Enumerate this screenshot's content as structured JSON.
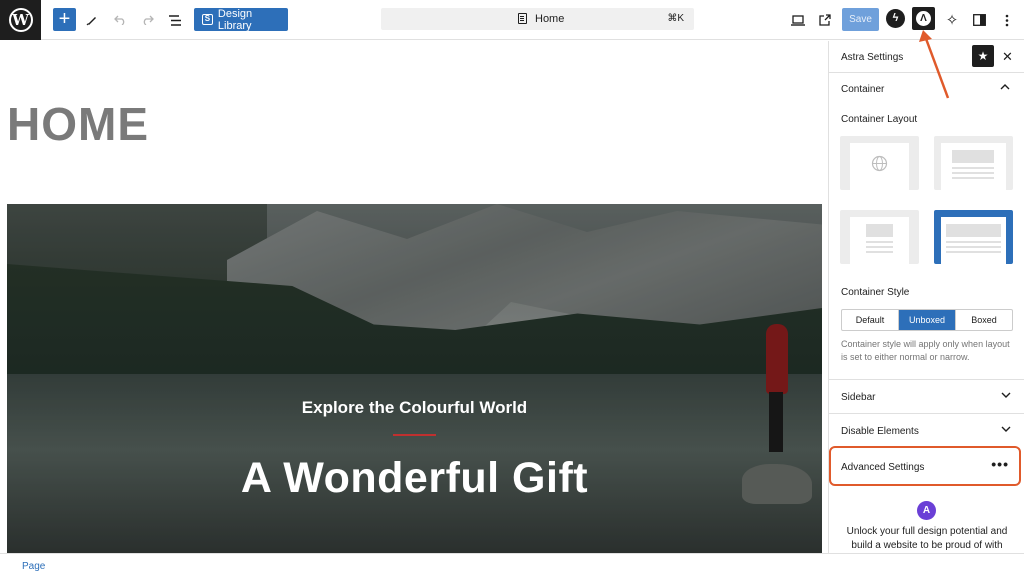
{
  "toolbar": {
    "logo_glyph": "W",
    "add_glyph": "+",
    "design_library_label": "Design Library",
    "command_bar_title": "Home",
    "command_bar_shortcut": "⌘K",
    "save_label": "Save",
    "icons": [
      "wordpress-logo-icon",
      "add-block-icon",
      "pen-tool-icon",
      "undo-icon",
      "redo-icon",
      "document-overview-icon",
      "design-library-icon",
      "page-icon",
      "desktop-preview-icon",
      "external-link-icon",
      "spectra-icon",
      "astra-icon",
      "sparkle-icon",
      "sidebar-toggle-icon",
      "more-options-icon"
    ]
  },
  "canvas": {
    "page_title": "HOME",
    "cover_subtitle": "Explore the Colourful World",
    "cover_title": "A Wonderful Gift"
  },
  "sidebar": {
    "title": "Astra Settings",
    "star_glyph": "★",
    "close_glyph": "✕",
    "container_section": "Container",
    "container_layout_label": "Container Layout",
    "container_style_label": "Container Style",
    "container_style_options": [
      "Default",
      "Unboxed",
      "Boxed"
    ],
    "container_style_selected": "Unboxed",
    "container_style_help": "Container style will apply only when layout is set to either normal or narrow.",
    "sidebar_section": "Sidebar",
    "disable_elements_section": "Disable Elements",
    "advanced_settings_section": "Advanced Settings",
    "astra_logo_glyph": "A",
    "promo_text": "Unlock your full design potential and build a website to be proud of with"
  },
  "footer": {
    "breadcrumb": "Page"
  },
  "colors": {
    "accent": "#2d6fb9",
    "highlight": "#e05a2b",
    "dark": "#1e1e1e"
  }
}
